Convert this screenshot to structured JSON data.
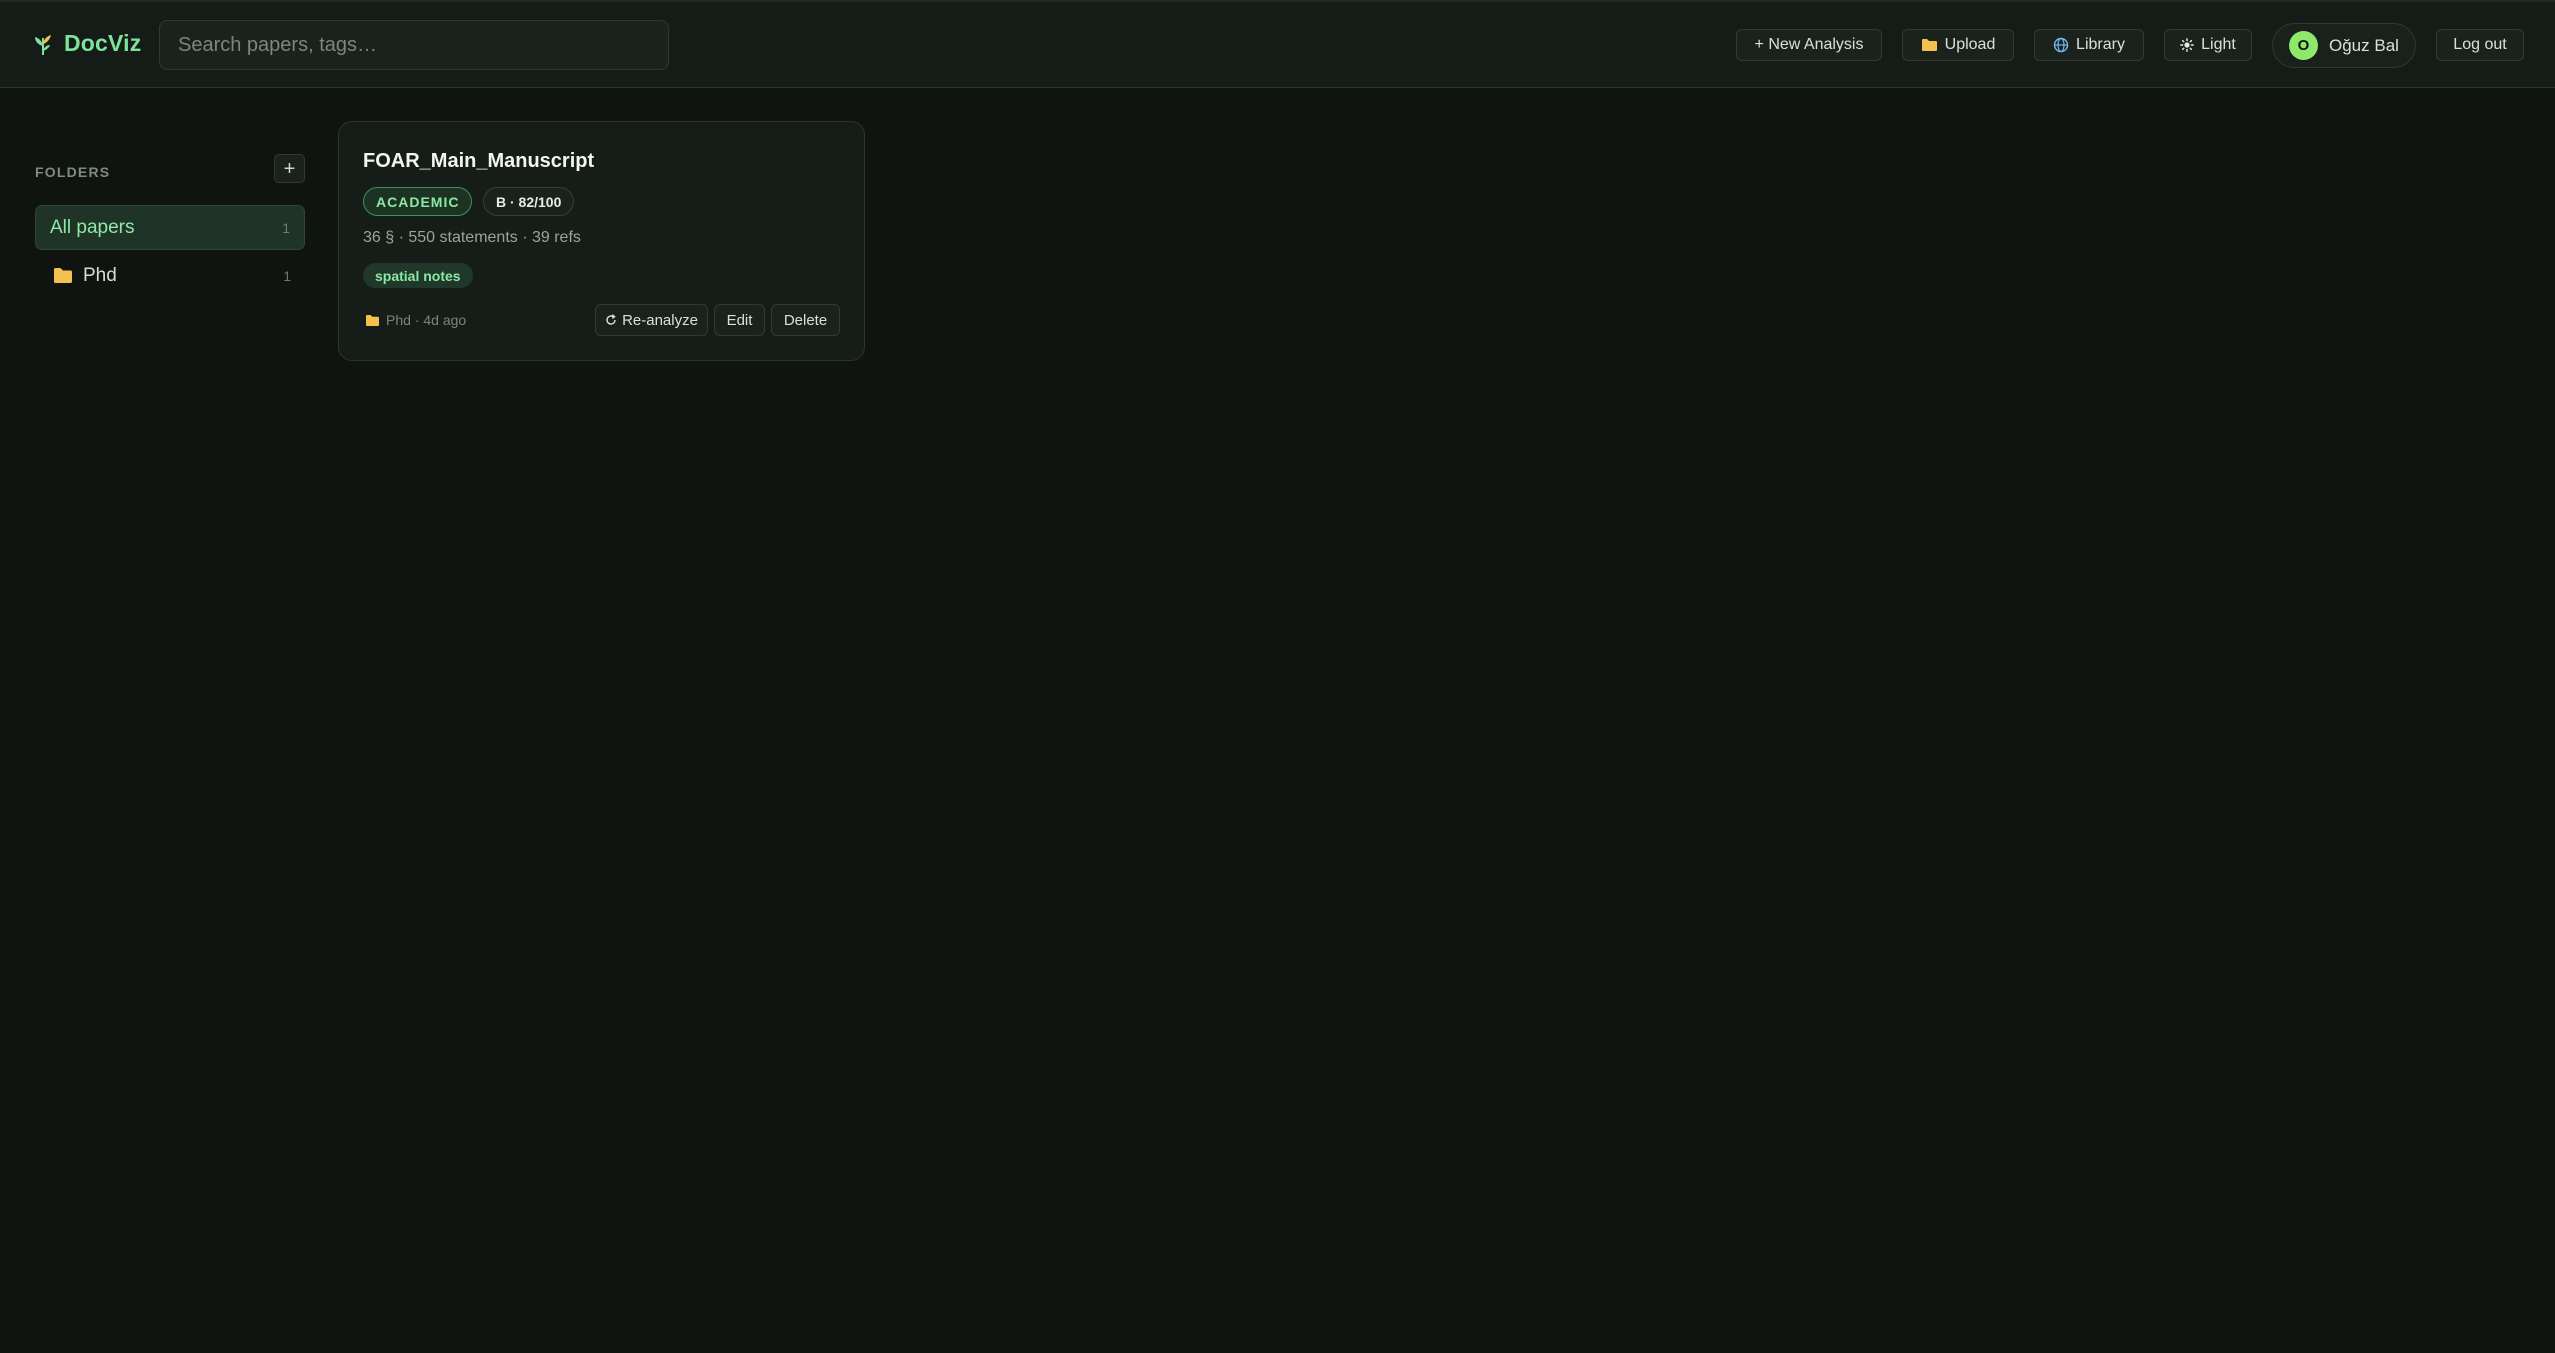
{
  "header": {
    "logo_text": "DocViz",
    "search_placeholder": "Search papers, tags…",
    "new_analysis_label": "+ New Analysis",
    "upload_label": "Upload",
    "library_label": "Library",
    "theme_label": "Light",
    "user": {
      "initial": "O",
      "name": "Oğuz Bal"
    },
    "logout_label": "Log out"
  },
  "sidebar": {
    "heading": "FOLDERS",
    "add_label": "+",
    "items": [
      {
        "label": "All papers",
        "count": "1",
        "active": true
      },
      {
        "label": "Phd",
        "count": "1",
        "icon": "folder-icon"
      }
    ]
  },
  "papers": [
    {
      "title": "FOAR_Main_Manuscript",
      "type_badge": "ACADEMIC",
      "grade_badge": "B · 82/100",
      "stats": "36 § · 550 statements · 39 refs",
      "tags": [
        "spatial notes"
      ],
      "meta": "Phd · 4d ago",
      "actions": {
        "reanalyze": "Re-analyze",
        "edit": "Edit",
        "delete": "Delete"
      }
    }
  ],
  "colors": {
    "background": "#0f1410",
    "accent": "#7fe29a",
    "folder": "#f2c14e"
  }
}
